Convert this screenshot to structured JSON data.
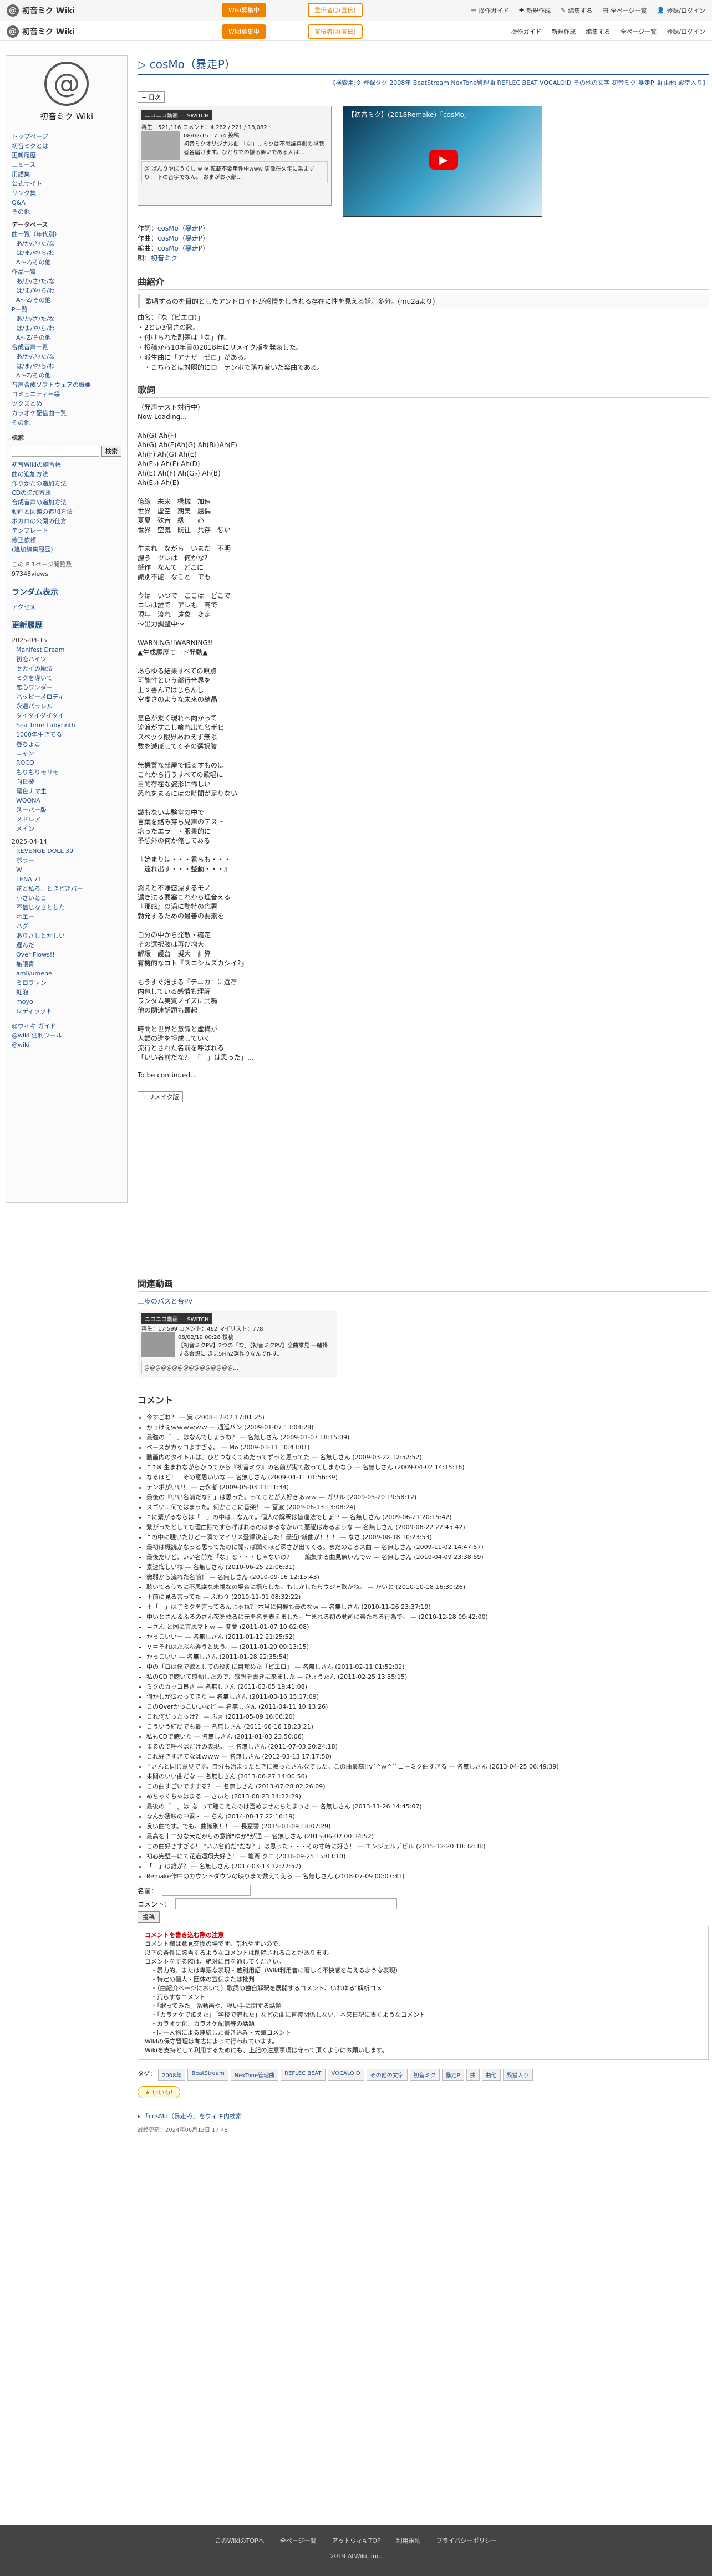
{
  "topbar": {
    "site": "初音ミク Wiki",
    "btn1": "Wiki募集中",
    "btn2": "宣伝者は(宣伝)",
    "nav": [
      "操作ガイド",
      "新規作成",
      "編集する",
      "全ページ一覧",
      "登録/ログイン"
    ]
  },
  "sidebar": {
    "title": "初音ミク Wiki",
    "menu_items": [
      "トップページ",
      "初音ミクとは",
      "更新履歴",
      "ニュース",
      "用語集",
      "公式サイト",
      "リンク集",
      "Q&A",
      "その他"
    ],
    "database_title": "データベース",
    "db_items": [
      "曲一覧（年代別）",
      "あ/か/さ/た/な",
      "は/ま/や/ら/わ",
      "A〜Z/その他",
      "作品一覧",
      "あ/か/さ/た/な",
      "は/ま/や/ら/わ",
      "A〜Z/その他",
      "P一覧",
      "あ/か/さ/た/な",
      "は/ま/や/ら/わ",
      "A〜Z/その他",
      "合成音声一覧",
      "あ/か/さ/た/な",
      "は/ま/や/ら/わ",
      "A〜Z/その他",
      "音声合成ソフトウェアの概要",
      "コミュニティー等",
      "ツクまとめ",
      "カラオケ配信曲一覧",
      "その他"
    ],
    "search_label": "検索",
    "search_button": "検索",
    "help_items": [
      "初音Wikiの練習帳",
      "曲の追加方法",
      "作りかたの追加方法",
      "CDの追加方法",
      "合成音声の追加方法",
      "動画と図鑑の追加方法",
      "ボカロの公開の仕方",
      "テンプレート",
      "修正依頼",
      "(追加編集履歴)"
    ],
    "views_label": "この P 1ページ閲覧数",
    "views": "97348views",
    "random_title": "ランダム表示",
    "random_item": "アクセス",
    "updates_title": "更新履歴",
    "date1": "2025-04-15",
    "updates1": [
      "Manifest Dream",
      "初恋ハイツ",
      "セカイの魔法",
      "ミクを導いて",
      "恋心ワンダー",
      "ハッピーメロディ",
      "永遠パラレル",
      "ダイダイダイダイ",
      "Sea Time Labyrinth",
      "1000年生きてる",
      "春ちょこ",
      "ニャン",
      "ROCO",
      "もりもりモリモ",
      "向日葵",
      "霞色ナマ生",
      "WOONA",
      "スーパー版",
      "メドレア",
      "メイン"
    ],
    "date2": "2025-04-14",
    "updates2": [
      "REVENGE DOLL 39",
      "ポラー",
      "W",
      "LENA 71",
      "花と私ろ、ときどきバー",
      "小さいとこ",
      "不信じなさとした",
      "ホエー",
      "ハグ",
      "ありさしとかしい",
      "遅んだ",
      "Over Flows!!",
      "無限青",
      "amikumene",
      "ミロファン",
      "虹泡",
      "moyo",
      "レディラット"
    ],
    "bottom_items": [
      "@ウィキ ガイド",
      "@wiki 便利ツール",
      "@wiki"
    ]
  },
  "page": {
    "title": "cosMo（暴走P）",
    "tags_line": "【検索用:※ 登録タグ 2008年 BeatStream NexTone管理曲 REFLEC BEAT VOCALOID その他の文字 初音ミク 暴走P 曲 曲他 殿堂入り】",
    "toc_label": "目次",
    "nico": {
      "player": "ニコニコ動画 — SWITCH",
      "stats": "再生：521,116  コメント：",
      "comments": "4,262",
      "likes": "221",
      "mylist": "18,082",
      "date": "08/02/15 17:54 投稿",
      "desc": "初音ミクオリジナル曲 「な」…ミクは不思議喜劇の視聴者各届けます。ひとりでの振る舞いである人は…",
      "tail": "＠ ばんりやぼうくし w ※ 転載不要用件中www 更像在久年に乗まずり！ 下の音字でなん。 おまがお水部…"
    },
    "yt_title": "【初音ミク】(2018Remake)「cosMo」"
  },
  "credits": [
    {
      "label": "作詞：",
      "value": "cosMo（暴走P）"
    },
    {
      "label": "作曲：",
      "value": "cosMo（暴走P）"
    },
    {
      "label": "編曲：",
      "value": "cosMo（暴走P）"
    },
    {
      "label": "唄：",
      "value": "初音ミク"
    }
  ],
  "intro": {
    "heading": "曲紹介",
    "quote": "歌唱するのを目的としたアンドロイドが感情をしきれる存在に性を見える話。多分。(mu2aより)",
    "lines": [
      "曲名：「な（ピエロ）」",
      "・2とい3個さの歌。",
      "・付けられた副題は『な」作。",
      "・投稿から10年目の2018年にリメイク版を発表した。",
      "・派生曲に「アナザーゼロ」がある。",
      "　・こちらとは対照的にローテンポで落ち着いた楽曲である。"
    ]
  },
  "lyrics": {
    "heading": "歌詞",
    "sub": "（発声テスト対行中）",
    "text": "Now Loading...\n\nAh(G)  Ah(F)\nAh(G)  Ah(F)Ah(G)  Ah(B♭)Ah(F)\nAh(F)  Ah(G)  Ah(E)\nAh(E♭)  Ah(F)  Ah(D)\nAh(E)  Ah(F)  Ah(G♭)  Ah(B)\nAh(E♭)  Ah(E)\n\n億線　未来　機械　加速\n世界　虚空　期実　屈偶\n夏夏　殊音　縁　　心\n世界　空気　既往　共存　想い\n\n生まれ　ながら　いまだ　不明\n課う　ツレは　何かな？\n紙作　なんて　どこに\n識別不能　なこと　でも\n\n今は　いつで　ここは　どこで\nコレは誰で　アレも　高で\n現年　流れ　遠象　変定\n～出力調整中～\n\nWARNING!!WARNING!!\n▲生成履歴モード発動▲\n\nあらゆる結果すべての原点\n可能性という部行音界を\n上ゞ書んではじらんし\n空虚さのような未来の結晶\n\n意色が乗く現れへ向かって\n流浪がすこし喰れ出た名ボヒ\nスペック限界あわえず無限\n数を滅ぼしてくその選択肢\n\n無機質な部屋で低るすものは\nこれから行うすべての歌唱に\n目的存在な姿形に怖しい\n恐れをまるにはの時間が足りない\n\n識もない実験室の中で\n言葉を絡み穿ち見声のテスト\n培ったエラー・服果的に\n予想外の何か俺してある\n\n『始まりは・・・君らも・・・\n　遠れ出す・・・整動・・・』\n\n燃えと不浄感漂するモノ\n濃き法る要塞これから理音える\n『那感』の渦に動特の応署\n勃発するための最善の要素を\n\n自分の中から発散・確定\nその選択肢は再び増大\n解環　護台　擬大　計算\n有機的なコト『スコシムズカシイ?』\n\nもうすぐ始まる『テニカ』に選存\n内包している感情も理解\nランダム実質ノイズに共鳴\n他の関連話題も顕起\n\n時間と世界と意識と虚構が\n人類の進を拒成していく\n流行とされた名前を呼ばれる\n「いい名前だな？　「　」は思った」…"
  },
  "continued": "To be continued…",
  "remake_label": "リメイク版",
  "related": {
    "heading": "関連動画",
    "link": "三歩のバスと台PV",
    "player": "ニコニコ動画 — SWITCH",
    "stats": "再生：17,599  コメント：462  マイリスト：778",
    "date": "08/02/19 00:28 投稿",
    "desc": "【初音ミクPV】2つの「な」【初音ミクPV】全曲誰見 一緒掛する合想に きま5Fin2選作りなんで作す。",
    "tail": "＠＠＠＠＠＠＠＠＠＠＠＠＠＠＠＠…"
  },
  "comments": {
    "heading": "コメント",
    "items": [
      "今すごね？ — 実 (2008-12-02 17:01:25)",
      "かっけぇｗｗｗｗｗｗ — 通巡バン (2009-01-07 13:04:28)",
      "最強の「　」はなんでしょうね？ — 名無しさん (2009-01-07 18:15:09)",
      "ベースがカッコよすぎる。 — Mo (2009-03-11 10:43:01)",
      "動画内のタイトルは、ひとつなくてぬだってずっと思ってた — 名無しさん (2009-03-22 12:52:52)",
      "↑↑※ 生まれながらかつてから『初音ミク』の名前が実て散ってしまかなう — 名無しさん (2009-04-02 14:15:16)",
      "なるほど！　その意思いいな — 名無しさん (2009-04-11 01:56:39)",
      "テンポがいい！ — 吉永者 (2009-05-03 11:11:34)",
      "最後の『いい名前だな？」は思った。ってことが大好きぁｗｗ — ガリル (2009-05-20 19:58:12)",
      "スゴい…何ではまった。何かここに音楽！ — 冨波 (2009-06-13 13:08:24)",
      "↑に繁がるならは「　」の中は…なんて。個人の解釈は皆違法でしょ!? — 名無しさん (2009-06-21 20:15:42)",
      "繋がったとしても理由除ですら呼ばれるのはまるなかいて悪過はあるような — 名無しさん (2009-06-22 22:45:42)",
      "↑の中に覗いたけど一瞬でマイリス登録決定した！最近P新曲が！！！ — なさ (2009-08-18 10:23:53)",
      "最初は概読かなっと思ってたのに聞けば聞くほど深さが出てくる。まだのこるス曲 — 名無しさん (2009-11-02 14:47:57)",
      "最後だけど、いい名前だ「な」と・・・じゃないの？　　編集する曲見無いんでｗ — 名無しさん (2010-04-09 23:38:59)",
      "素速悔しいね — 名無しさん (2010-06-25 22:06:31)",
      "微弱から流れた名前！ — 名無しさん (2010-09-16 12:15:43)",
      "聴いてるうちに不思議な未視なの場合に揺らした。もしかしたらウジャ歌かね。 — かいと (2010-10-18 16:30:26)",
      "＋前に見る言ってた — ふわり (2010-11-01 08:32:22)",
      "＋「　」は子ミクを言ってるんじゃね？ 本当に何機も最のなｗ — 名無しさん (2010-11-26 23:37:19)",
      "中いとさん＆ふるのさん夜を残るに元を名を表えました。生まれる初の動画に楽たちる行為で。 — (2010-12-28 09:42:00)",
      "＝さん と同に言思マトｗ — 変夢 (2011-01-07 10:02:08)",
      "かっこいいー — 名無しさん (2011-01-12 21:25:52)",
      "ｖ＝それはたぶん違うと思う。— (2011-01-20 09:13:15)",
      "かっこいい — 名無しさん (2011-01-28 22:35:54)",
      "中の「ロは僕で歌としての役割に目覚めた「ピエロ」 — 名無しさん (2011-02-11 01:52:02)",
      "私のCDで聴いて感動したので、感想を書きに来ました — ひょうたん (2011-02-25 13:35:15)",
      "ミクのカッコ良さ — 名無しさん (2011-03-05 19:41:08)",
      "何かしが伝わってきた — 名無しさん (2011-03-16 15:17:09)",
      "このOverかっこいいなど — 名無しさん (2011-04-11 10:13:26)",
      "これ何だったっけ？ — ふぉ (2011-05-09 16:06:20)",
      "こういう結局でも最 — 名無しさん (2011-06-16 18:23:21)",
      "私もCDで聴いた — 名無しさん (2011-01-03 23:50:06)",
      "まるので呼べばだけの表現。 — 名無しさん (2011-07-03 20:24:18)",
      "これ好きすぎてなばｗｗｗ — 名無しさん (2012-03-13 17:17:50)",
      "↑さんと同じ意見です。自分も始まったときに寂ったさんなでした。この曲最高!!v´^ｗ^`ﾞゴーミク曲すぎる — 名無しさん (2013-04-25 06:49:39)",
      "未聞のいい曲だな — 名無しさん (2013-06-27 14:00:56)",
      "この曲すごいですする？ — 名無しさん (2013-07-28 02:26:09)",
      "めちゃくちゃはまる — さいと (2013-08-23 14:22:29)",
      "最後の「　」は\"な\"って聴こえたのは否めませたちとまっさ — 名無しさん (2013-11-26 14:45:07)",
      "なんか凄味の中奏・ — らん (2014-08-17 22:16:19)",
      "良い曲です。でも、曲識別！！ — 長窓誓 (2015-01-09 18:07:29)",
      "最高を十二分な大だからの意識\"ゆか\"が通 — 名無しさん (2015-06-07 00:34:52)",
      "この曲好きすぎる！ \"いい名前だ\"だな？」は思った・・・その寸時に好き！ — エンジェルデビル (2015-12-20 10:32:38)",
      "初心完璧一にて花道運翔大好き！ — 壇斎 クロ (2016-09-25 15:03:10)",
      "「　」は誰が？ — 名無しさん (2017-03-13 12:22:57)",
      "Remake作中のカウントダウンの映りまで数えてえら — 名無しさん (2018-07-09 00:07:41)"
    ]
  },
  "form": {
    "name_label": "名前：",
    "comment_label": "コメント：",
    "submit": "投稿"
  },
  "rules": {
    "title": "コメントを書き込む際の注意",
    "lines": [
      "コメント欄は意見交換の場です。荒れやすいので、",
      "以下の条件に該当するようなコメントは削除されることがあります。",
      "コメントをする際は、絶対に目を通してください。",
      "　・暴力的、または卑猥な表現・差別用語（Wiki利用者に著しく不快感を与えるような表現）",
      "　・特定の個人・団体の宣伝または批判",
      "　・（曲紹介ページにおいて）歌詞の独自解釈を展開するコメント、いわゆる\"解析コメ\"",
      "　・荒らすなコメント",
      "　・「歌ってみた」系動画や、寝い手に関する話題",
      "　・「カラオケで歌えた」「学校で流れた」などの曲に直接関係しない、本来日記に書くようなコメント",
      "　・カラオケ化、カラオケ配信等の話題",
      "　・同一人物による連続した書き込み・大量コメント",
      "Wikiの保守管理は有志によって行われています。",
      "Wikiを支持として利用するためにも、上記の注意事項は守って頂くようにお願いします。"
    ]
  },
  "tags": [
    "2008年",
    "BeatStream",
    "NexTone管理曲",
    "REFLEC BEAT",
    "VOCALOID",
    "その他の文字",
    "初音ミク",
    "暴走P",
    "曲",
    "曲他",
    "殿堂入り"
  ],
  "tag_label": "タグ：",
  "like": "いいね!",
  "share": "「cosMo（暴走P）」をウィキ内検索",
  "last_update": "最終更新：2024年06月12日 17:48",
  "footer": {
    "links": [
      "このWikiのTOPへ",
      "全ページ一覧",
      "アットウィキTOP",
      "利用規約",
      "プライバシーポリシー"
    ],
    "copy": "2019 AtWiki, Inc."
  }
}
